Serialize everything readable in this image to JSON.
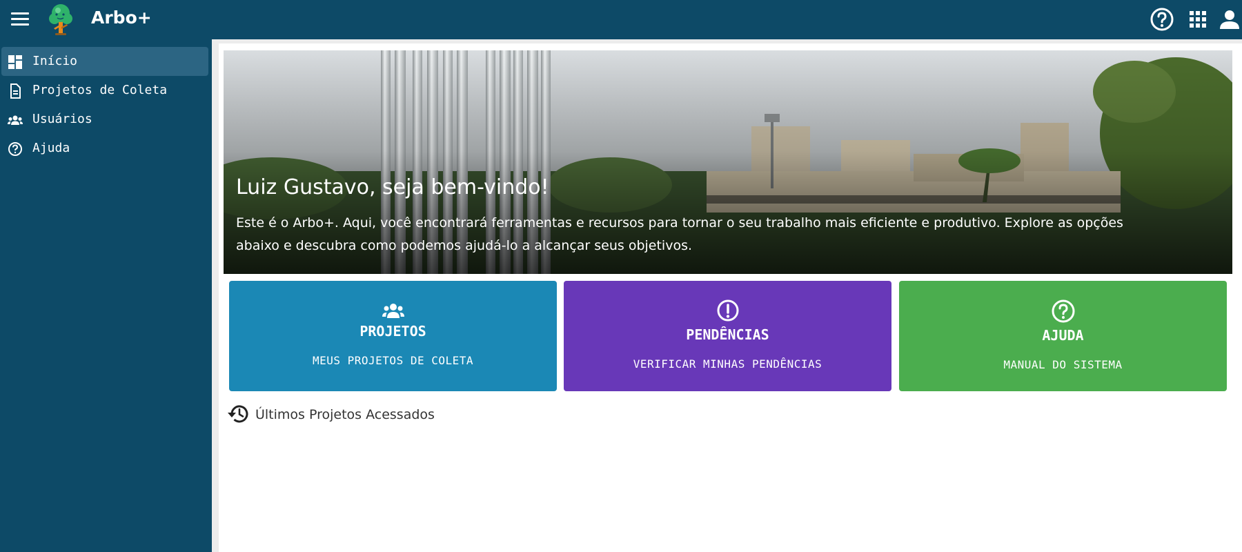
{
  "app": {
    "title": "Arbo+"
  },
  "topbar": {
    "icons": [
      "menu-icon",
      "help-circle-icon",
      "apps-grid-icon",
      "account-icon"
    ]
  },
  "sidebar": {
    "items": [
      {
        "label": "Início",
        "icon": "dashboard-icon",
        "active": true
      },
      {
        "label": "Projetos de Coleta",
        "icon": "document-icon",
        "active": false
      },
      {
        "label": "Usuários",
        "icon": "users-icon",
        "active": false
      },
      {
        "label": "Ajuda",
        "icon": "help-circle-icon",
        "active": false
      }
    ]
  },
  "hero": {
    "title": "Luiz Gustavo, seja bem-vindo!",
    "text": "Este é o Arbo+. Aqui, você encontrará ferramentas e recursos para tornar o seu trabalho mais eficiente e produtivo. Explore as opções abaixo e descubra como podemos ajudá-lo a alcançar seus objetivos."
  },
  "cards": [
    {
      "title": "PROJETOS",
      "subtitle": "MEUS PROJETOS DE COLETA",
      "icon": "users-icon",
      "color": "#1b88b5"
    },
    {
      "title": "PENDÊNCIAS",
      "subtitle": "VERIFICAR MINHAS PENDÊNCIAS",
      "icon": "alert-circle-icon",
      "color": "#6838b8"
    },
    {
      "title": "AJUDA",
      "subtitle": "MANUAL DO SISTEMA",
      "icon": "help-circle-icon",
      "color": "#4bad4e"
    }
  ],
  "recent": {
    "label": "Últimos Projetos Acessados",
    "icon": "history-icon"
  },
  "colors": {
    "topbar": "#0d4a67",
    "sidebar_active": "#2c6583"
  }
}
